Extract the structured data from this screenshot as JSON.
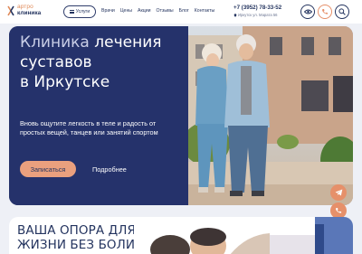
{
  "logo": {
    "line1": "артро",
    "line2": "клиника"
  },
  "header": {
    "services_label": "Услуги",
    "nav": [
      "Врачи",
      "Цены",
      "Акции",
      "Отзывы",
      "Блог",
      "Контакты"
    ],
    "phone": "+7 (3952) 78-33-52",
    "address": "Иркутск ул. Марата 56"
  },
  "hero": {
    "title_accent": "Клиника",
    "title_rest_1": " лечения",
    "title_line2": "суставов",
    "title_line3": "в Иркутске",
    "subtitle": "Вновь ощутите легкость в теле и радость от простых вещей, танцев или занятий спортом",
    "cta_label": "Записаться",
    "more_label": "Подробнее"
  },
  "section2": {
    "title": "ВАША ОПОРА ДЛЯ ЖИЗНИ БЕЗ БОЛИ"
  },
  "colors": {
    "navy": "#25326b",
    "accent": "#eaa07e",
    "bg": "#eef0f6"
  },
  "icons": [
    "eye-icon",
    "phone-icon",
    "search-icon",
    "telegram-icon",
    "call-icon",
    "chevron-down-icon"
  ]
}
